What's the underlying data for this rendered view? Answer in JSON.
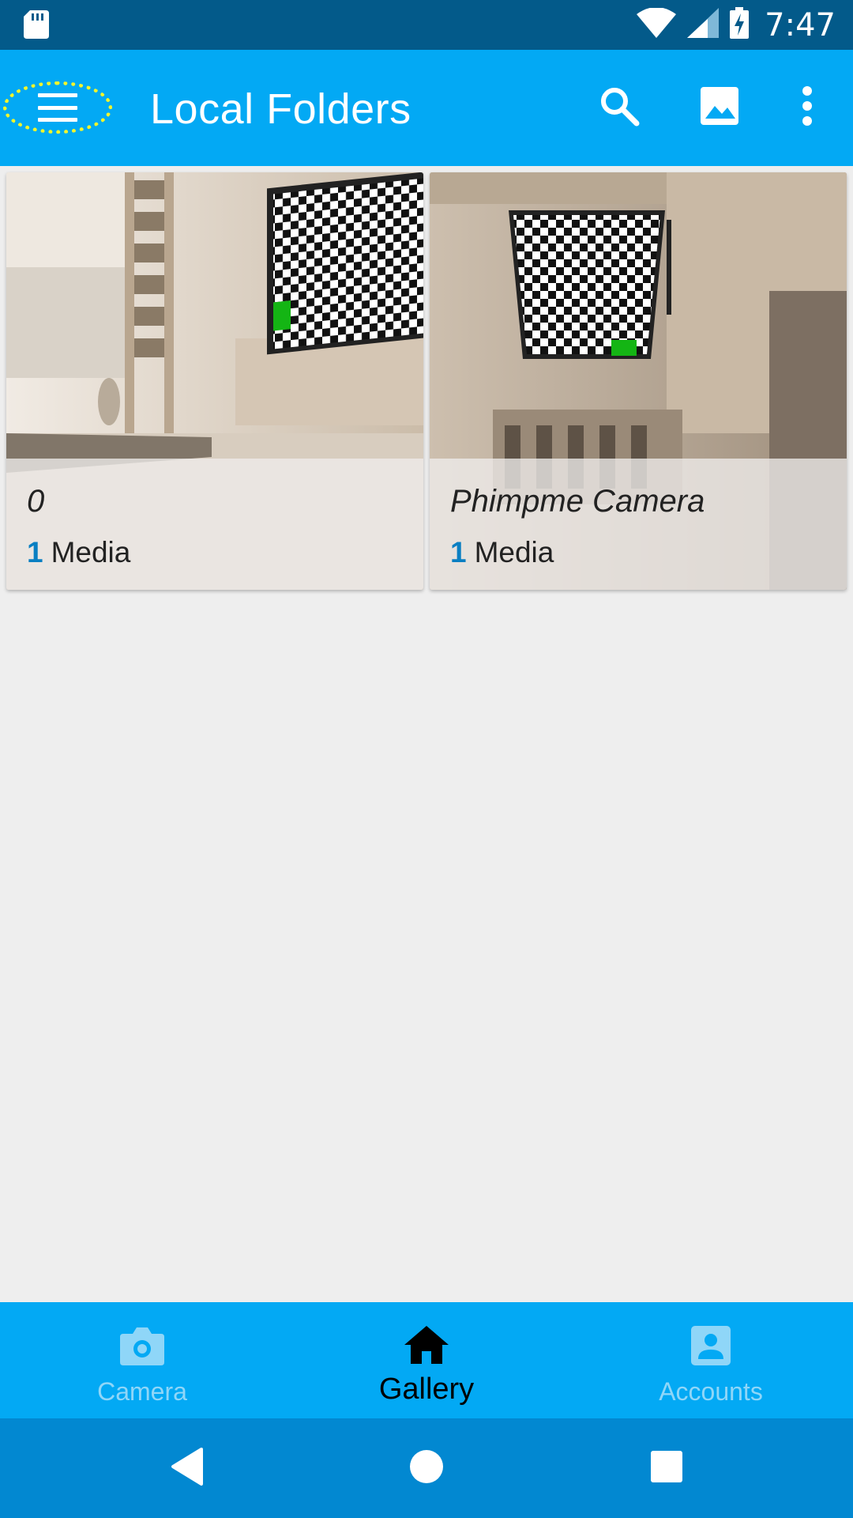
{
  "status_bar": {
    "time": "7:47",
    "icons": [
      "sd-card-icon",
      "wifi-icon",
      "cell-signal-icon",
      "battery-charging-icon"
    ]
  },
  "app_bar": {
    "title": "Local Folders",
    "icons": [
      "menu-icon",
      "search-icon",
      "image-icon",
      "more-vert-icon"
    ],
    "highlight_color": "#f2f52b"
  },
  "folders": [
    {
      "name": "0",
      "count": "1",
      "count_label": "Media"
    },
    {
      "name": "Phimpme Camera",
      "count": "1",
      "count_label": "Media"
    }
  ],
  "bottom_nav": {
    "items": [
      {
        "label": "Camera",
        "icon": "camera-icon",
        "active": false
      },
      {
        "label": "Gallery",
        "icon": "home-icon",
        "active": true
      },
      {
        "label": "Accounts",
        "icon": "account-box-icon",
        "active": false
      }
    ]
  },
  "colors": {
    "primary": "#03a9f4",
    "primary_dark": "#035a8a",
    "nav_bar": "#0288d1",
    "accent_count": "#0a7fc2",
    "background": "#eeeeee"
  }
}
